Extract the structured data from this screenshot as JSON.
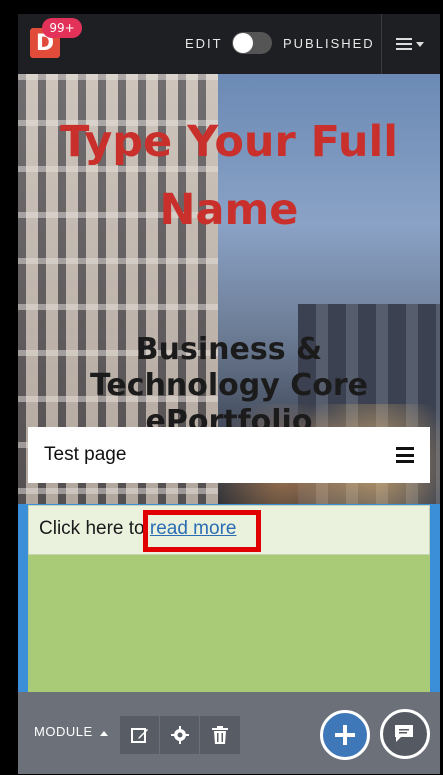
{
  "topbar": {
    "logo_letter": "D",
    "badge_count": "99+",
    "edit_label": "EDIT",
    "published_label": "PUBLISHED",
    "menu_icon": "hamburger-caret-icon"
  },
  "hero": {
    "name_line1": "Type Your Full",
    "name_line2": "Name",
    "subtitle_line1": "Business &",
    "subtitle_line2": "Technology Core",
    "subtitle_line3": "ePortfolio"
  },
  "navbar": {
    "title": "Test page"
  },
  "content": {
    "text_prefix": "Click here to ",
    "link_text": "read more"
  },
  "bottombar": {
    "module_label": "MODULE",
    "tools": [
      "edit-icon",
      "gear-icon",
      "trash-icon"
    ]
  },
  "colors": {
    "accent_red": "#c9302c",
    "badge": "#e2325a",
    "content_green": "#a9cb77",
    "frame_blue": "#3a8fd8",
    "add_button": "#3e78b8"
  }
}
